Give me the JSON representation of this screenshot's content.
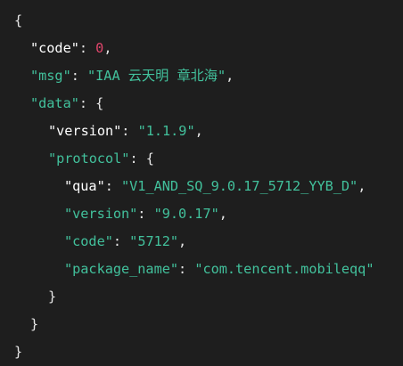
{
  "code_block": {
    "colors": {
      "background": "#1e1e1e",
      "punctuation": "#e6e6e6",
      "key_white": "#ffffff",
      "key_green": "#42c19c",
      "string": "#42c19c",
      "number": "#e0456b"
    },
    "open_brace": "{",
    "close_brace": "}",
    "code": {
      "key": "\"code\"",
      "value": "0"
    },
    "msg": {
      "key": "\"msg\"",
      "value": "\"IAA 云天明 章北海\""
    },
    "data": {
      "key": "\"data\"",
      "open": "{",
      "close": "}",
      "version": {
        "key": "\"version\"",
        "value": "\"1.1.9\""
      },
      "protocol": {
        "key": "\"protocol\"",
        "open": "{",
        "close": "}",
        "qua": {
          "key": "\"qua\"",
          "value": "\"V1_AND_SQ_9.0.17_5712_YYB_D\""
        },
        "version": {
          "key": "\"version\"",
          "value": "\"9.0.17\""
        },
        "code": {
          "key": "\"code\"",
          "value": "\"5712\""
        },
        "package_name": {
          "key": "\"package_name\"",
          "value": "\"com.tencent.mobileqq\""
        }
      }
    },
    "colon": ": ",
    "comma": ","
  }
}
